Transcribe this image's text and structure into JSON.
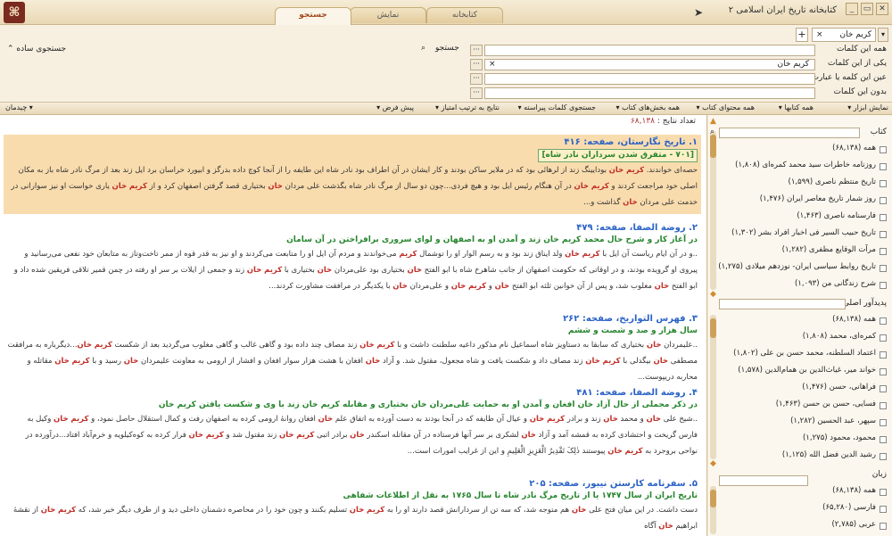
{
  "window": {
    "title": "کتابخانه تاریخ ایران اسلامی ۲",
    "tabs": [
      "کتابخانه",
      "نمایش",
      "جستجو"
    ],
    "controls": [
      "_",
      "▭",
      "✕"
    ]
  },
  "search": {
    "query_tag": "کریم خان",
    "add_symbol": "+",
    "tag_close": "×",
    "label_search": "جستجو",
    "simple_search": "جستجوی ساده",
    "rows": [
      {
        "label": "همه این کلمات",
        "value": ""
      },
      {
        "label": "یکی از این کلمات",
        "value": "کریم خان"
      },
      {
        "label": "عین این کلمه یا عبارت",
        "value": ""
      },
      {
        "label": "بدون این کلمات",
        "value": ""
      }
    ]
  },
  "toolbar": {
    "show_tools": "نمایش ابزار",
    "all_books": "همه کتابها",
    "all_content": "همه محتوای کتاب",
    "all_sections": "همه بخش‌های کتاب",
    "search_words": "جستجوی کلمات پیراسته",
    "sort": "نتایج به ترتیب امتیاز",
    "default": "پیش فرض",
    "layout": "چیدمان"
  },
  "results": {
    "count_label": "تعداد نتایج :",
    "count": "۶۸,۱۳۸",
    "items": [
      {
        "title": "۱. تاریخ نگارستان، صفحه: ۴۱۶",
        "sub": "[۷۰۱ - متفرق شدن سرداران نادر شاه]",
        "text": "حصه‌ای خواندند. کریم خان بودایینگ زند از لرهائی بود که در ملایر ساکن بودند و کار ایشان در آن اطراف بود نادر شاه این طایفه را از آنجا کوچ داده بدرگز و ابیورد خراسان برد ایل زند بعد از مرگ نادر شاه باز به مکان اصلی خود مراجعت کردند و کریم خان در آن هنگام رئیس ایل بود و هیچ فردی...چون دو سال از مرگ نادر شاه بگذشت علی مردان خان بختیاری قصد گرفتن اصفهان کرد و از کریم خان یاری خواست او نیز سوارانی در خدمت علی مردان خان گذاشت و..."
      },
      {
        "title": "۲. روضة الصفا، صفحه: ۴۷۹",
        "sub": "در آغاز کار و شرح حال محمد کریم خان زند و آمدن او به اصفهان و لوای سروری برافراختن در آن سامان",
        "text": "..و در آن ایام ریاست آن ایل با کریم خان ولد ایناق زند بود و به رسم الوار او را توشمال کریم می‌خواندند و مردم آن ایل او را متابعت می‌کردند و او نیز به قدر قوه از ممر تاخت‌وتاز به متابعان خود نفعی می‌رسانید و پیروی او گرویده بودند، و در اوقاتی که حکومت اصفهان از جانب شاهرخ شاه با ابو الفتح خان بختیاری بود علی‌مردان خان بختیاری با کریم خان زند و جمعی از ایلات بر سر او رفته در چمن قمیر تلاقی فریقین شده داد و ابو الفتح خان مغلوب شد، و پس از آن خوانین ثلثه ابو الفتح خان و کریم خان و علی‌مردان خان با یکدیگر در مرافقت مشاورت کردند..."
      },
      {
        "title": "۳. فهرس التواریخ، صفحه: ۲۶۲",
        "sub": "سال هزار و صد و شصت و ششم",
        "text": "..علیمردان خان بختیاری که سابقا به دستاویز شاه اسماعیل نام مذکور داعیه سلطنت داشت و با کریم خان زند مصاف چند داده بود و گاهی غالب و گاهی مغلوب می‌گردید بعد از شکست کریم خان...دیگرباره به مرافقت مصطفی خان بیگدلی با کریم خان زند مصاف داد و شکست یافت و شاه مجعول، مقتول شد. و آزاد خان افغان با هشت هزار سوار افغان و افشار از ارومی به معاونت علیمردان خان رسید و با کریم خان مقاتله و محاربه دریپوست..."
      },
      {
        "title": "۴. روضة الصفا، صفحه: ۴۸۱",
        "sub": "در ذکر مجملی از حال آزاد خان افغان و آمدن او به حمایت علی‌مردان خان بختیاری و مقابله کریم خان زند با وی و شکست یافتن کریم خان",
        "text": "..شیخ علی خان و محمد خان زند و برادر کریم خان و عیال آن طایفه که در آنجا بودند به دست آورده به اتفاق علم خان افغان روانهٔ ارومی کرده به اصفهان رفت و کمال استقلال حاصل نمود، و کریم خان وکیل به فارس گریخت و احتشادی کرده به قمشه آمد و آزاد خان لشکری بر سر آنها فرستاده در آن مقاتله اسکندر خان برادر اتبی کریم خان زند مقتول شد و کریم خان فرار کرده به کوه‌کیلویه و خرم‌آباد افتاد...درآورده در نواحی بروجرد به کریم خان پیوستند ذٰلِکَ تَقْدِیرُ الْعَزِیزِ الْعَلِیمِ و این از غرایب امورات است..."
      },
      {
        "title": "۵. سفرنامه کارستن نیبور، صفحه: ۲۰۵",
        "sub": "تاریخ ایران از سال ۱۷۴۷ یا از تاریخ مرگ نادر شاه تا سال ۱۷۶۵ به نقل از اطلاعات شفاهی",
        "text": "دست داشت. در این میان فتح علی خان هم متوجه شد، که سه تن از سردارانش قصد دارند او را به کریم خان تسلیم بکنند و چون خود را در محاصره دشمنان داخلی دید و از طرف دیگر خبر شد، که کریم خان از نقشهٔ ابراهیم خان آگاه"
      }
    ]
  },
  "sidebar": {
    "books": {
      "title": "کتاب",
      "items": [
        "همه (۶۸,۱۳۸)",
        "روزنامه خاطرات سید محمد کمره‌ای (۱,۸۰۸)",
        "تاریخ منتظم ناصری (۱,۵۹۹)",
        "روز شمار تاریخ معاصر ایران (۱,۴۷۶)",
        "فارسنامه ناصری (۱,۴۶۳)",
        "تاریخ حبیب السیر فی اخبار افراد بشر (۱,۳۰۲)",
        "مرآت الوقایع مظفری (۱,۲۸۲)",
        "تاریخ روابط سیاسی ایران- نوزدهم میلادی (۱,۲۷۵)",
        "شرح زندگانی من (۱,۰۹۳)"
      ]
    },
    "authors": {
      "title": "پدیدآور اصلی",
      "items": [
        "همه (۶۸,۱۳۸)",
        "کمره‌ای، محمد (۱,۸۰۸)",
        "اعتماد السلطنه، محمد حسن بن علی (۱,۸۰۲)",
        "خواند میر، غیاث‌الدین بن همام‌الدین (۱,۵۷۸)",
        "فراهانی، حسن (۱,۴۷۶)",
        "فسایی، حسن بن حسن (۱,۴۶۳)",
        "سپهر، عبد الحسین (۱,۲۸۲)",
        "محمود، محمود (۱,۲۷۵)",
        "رشید الدین فضل الله (۱,۱۲۵)"
      ]
    },
    "languages": {
      "title": "زبان",
      "items": [
        "همه (۶۸,۱۳۸)",
        "فارسی (۶۵,۲۸۰)",
        "عربی (۲,۷۸۵)"
      ]
    }
  }
}
